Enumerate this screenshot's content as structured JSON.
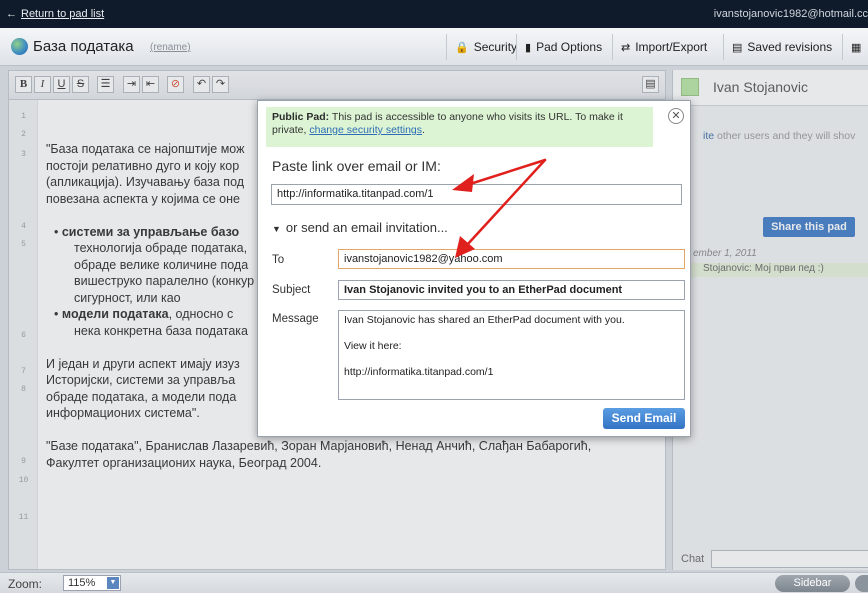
{
  "topbar": {
    "back_link": "Return to pad list",
    "user_email": "ivanstojanovic1982@hotmail.cc"
  },
  "titlebar": {
    "title": "База података",
    "rename": "(rename)",
    "buttons": {
      "security": "Security",
      "pad_options": "Pad Options",
      "import_export": "Import/Export",
      "saved_revisions": "Saved revisions"
    }
  },
  "editor": {
    "line_numbers": [
      "1",
      "2",
      "3",
      "4",
      "5",
      "6",
      "7",
      "8",
      "9",
      "10",
      "11"
    ],
    "lines": [
      "\"База података се најопштије мож",
      "постоји релативно дуго и коју кор",
      "(апликација). Изучавању база под",
      "повезана аспекта у којима се оне",
      "системи за управљање базо",
      "технологија обраде података,",
      "обраде велике количине пода",
      "вишеструко паралелно (конкур",
      "сигурност, или као",
      "модели података",
      ", односно с",
      "нека конкретна база података",
      "И један и други аспект имају изуз",
      "Историјски, системи за управља",
      "обраде података, а модели пода",
      "информационих система\".",
      "\"Базе података\", Бранислав Лазаревић, Зоран Марјановић, Ненад Анчић, Слађан Бабарогић,",
      "Факултет организационих наука, Београд 2004."
    ]
  },
  "sidebar": {
    "user_name": "Ivan Stojanovic",
    "invite_link": "ite",
    "invite_text": " other users and they will shov",
    "share_button": "Share this pad",
    "chat_date": "ember 1, 2011",
    "chat_message": "Stojanovic: Мој први пед :)",
    "chat_label": "Chat"
  },
  "bottombar": {
    "zoom_label": "Zoom:",
    "zoom_value": "115%",
    "sidebar_button": "Sidebar"
  },
  "modal": {
    "notice_bold": "Public Pad:",
    "notice_text": " This pad is accessible to anyone who visits its URL. To make it private, ",
    "notice_link": "change security settings",
    "notice_end": ".",
    "paste_label": "Paste link over email or IM:",
    "pad_url": "http://informatika.titanpad.com/1",
    "or_send": "or send an email invitation...",
    "to_label": "To",
    "to_value": "ivanstojanovic1982@yahoo.com",
    "subject_label": "Subject",
    "subject_value": "Ivan Stojanovic invited you to an EtherPad document",
    "message_label": "Message",
    "message_lines": [
      "Ivan Stojanovic has shared an EtherPad document with you.",
      "",
      "View it here:",
      "",
      "http://informatika.titanpad.com/1"
    ],
    "send_button": "Send Email"
  },
  "icons": {
    "back": "left-arrow-icon",
    "globe": "globe-icon",
    "lock": "lock-icon",
    "page": "page-icon",
    "swap": "swap-arrows-icon",
    "save": "save-icon",
    "close": "close-icon",
    "triangle": "triangle-down-icon"
  },
  "colors": {
    "topbar": "#0f1a2a",
    "notice_bg": "#dcf4d3",
    "send_button": "#3d7cc9",
    "annotation_arrow": "#e0201d"
  }
}
